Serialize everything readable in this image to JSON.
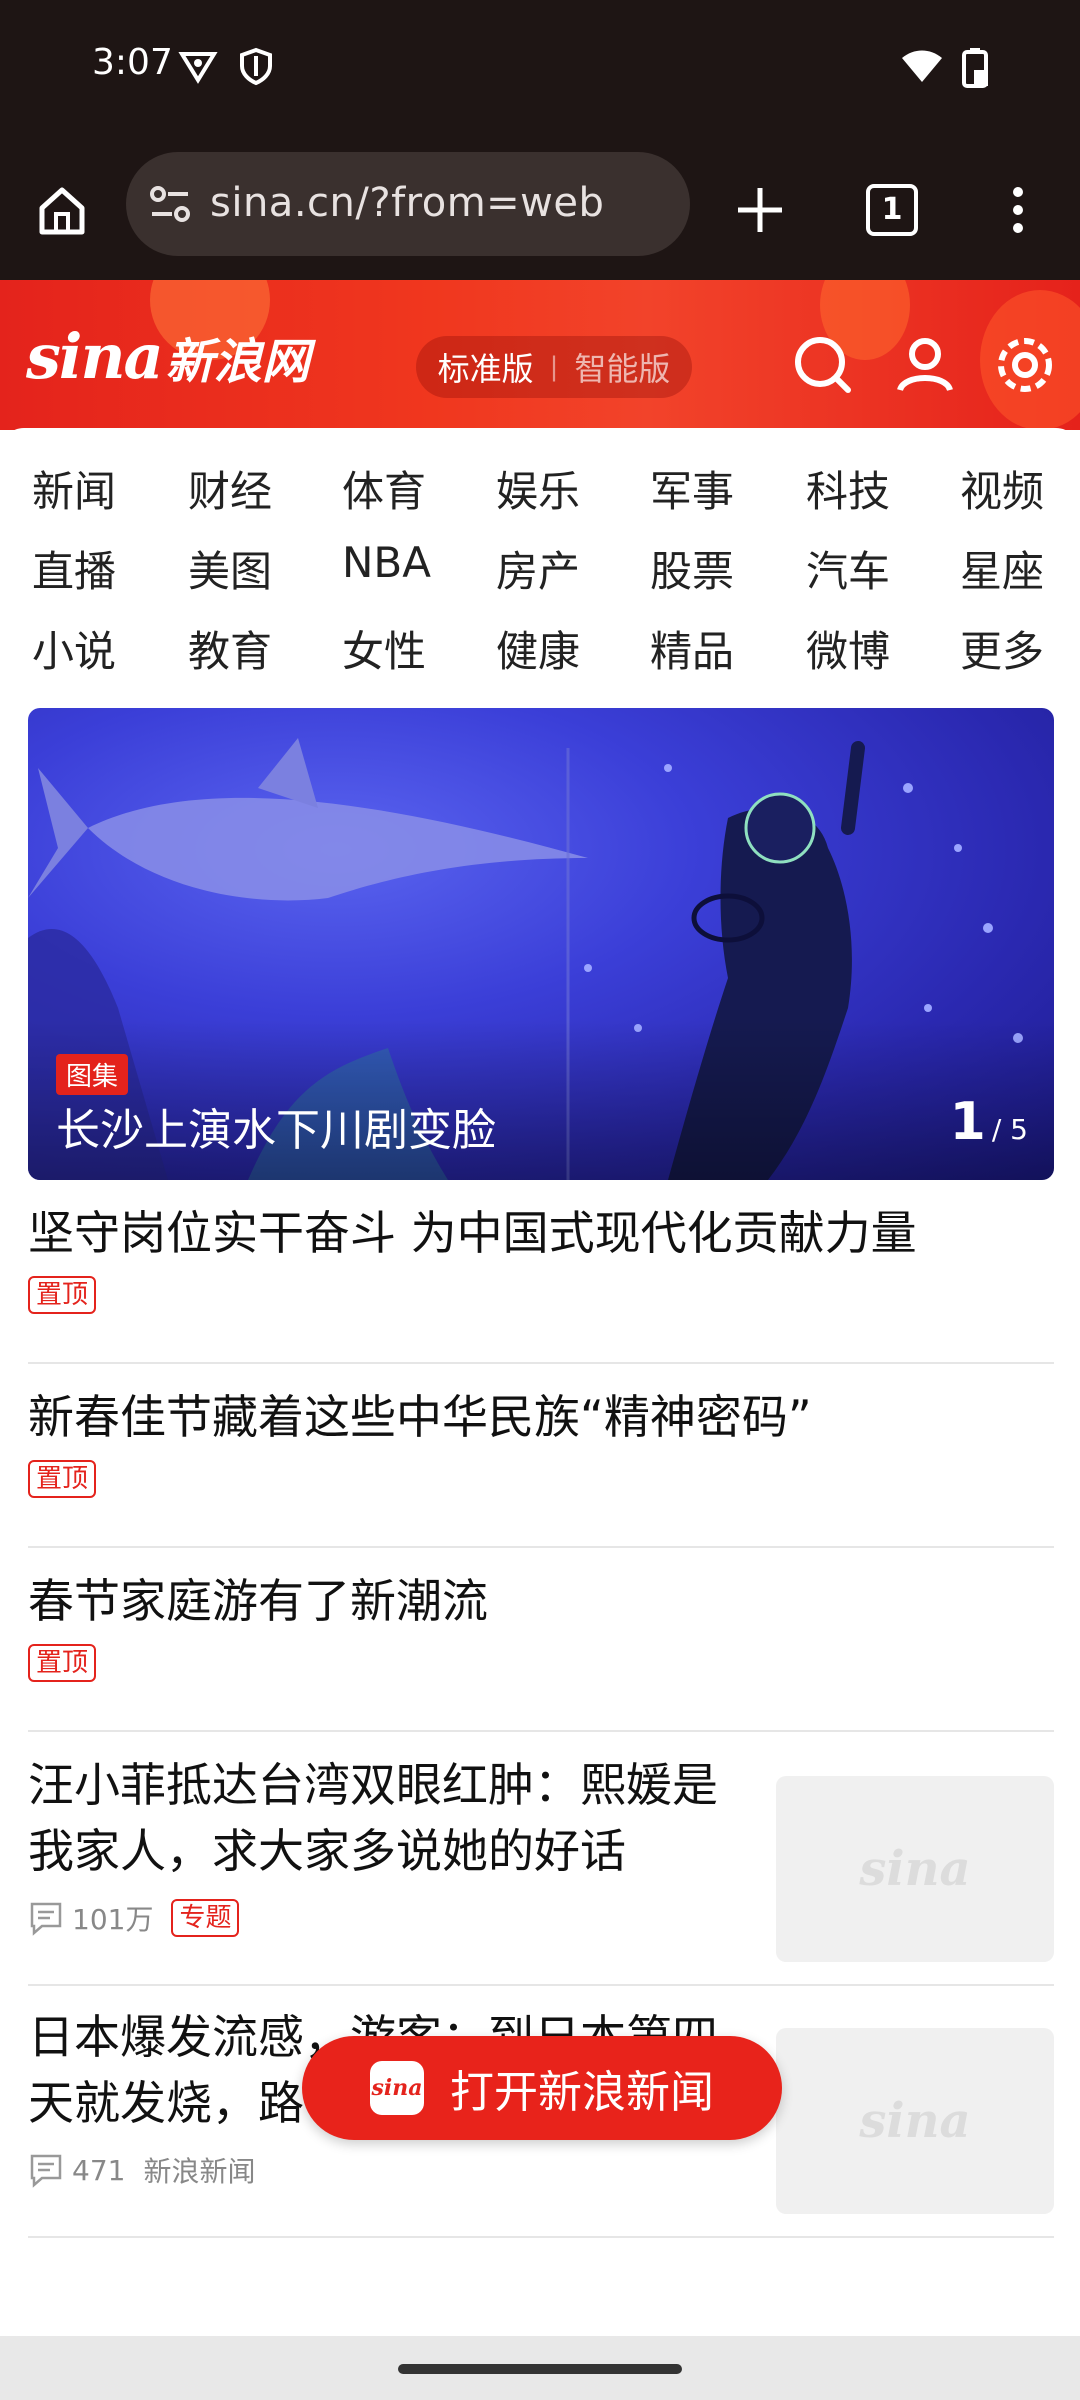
{
  "status_bar": {
    "time": "3:07"
  },
  "browser": {
    "url": "sina.cn/?from=web",
    "tab_count": "1"
  },
  "header": {
    "logo_en": "sina",
    "logo_cn": "新浪网",
    "version_standard": "标准版",
    "version_smart": "智能版"
  },
  "categories": [
    "新闻",
    "财经",
    "体育",
    "娱乐",
    "军事",
    "科技",
    "视频",
    "直播",
    "美图",
    "NBA",
    "房产",
    "股票",
    "汽车",
    "星座",
    "小说",
    "教育",
    "女性",
    "健康",
    "精品",
    "微博",
    "更多"
  ],
  "carousel": {
    "badge": "图集",
    "title": "长沙上演水下川剧变脸",
    "current": "1",
    "total": "/ 5"
  },
  "news": [
    {
      "title": "坚守岗位实干奋斗 为中国式现代化贡献力量",
      "badge": "置顶"
    },
    {
      "title": "新春佳节藏着这些中华民族“精神密码”",
      "badge": "置顶"
    },
    {
      "title": "春节家庭游有了新潮流",
      "badge": "置顶"
    },
    {
      "title": "汪小菲抵达台湾双眼红肿：熙媛是我家人，求大家多说她的好话",
      "comments": "101万",
      "tag": "专题"
    },
    {
      "title": "日本爆发流感，游客：到日本第四天就发烧，路",
      "comments": "471",
      "source": "新浪新闻"
    }
  ],
  "thumb_logo": "sina",
  "open_app": {
    "icon_text": "sina",
    "label": "打开新浪新闻"
  }
}
